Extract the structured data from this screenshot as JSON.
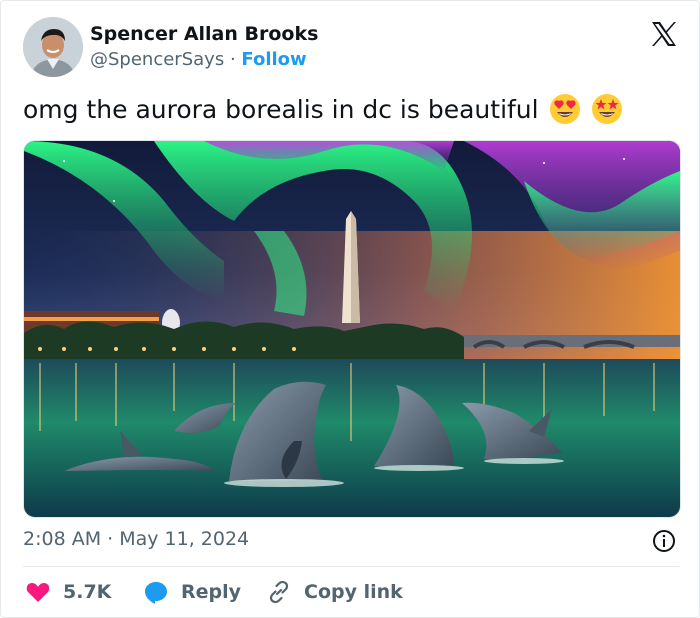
{
  "user": {
    "name": "Spencer Allan Brooks",
    "handle": "@SpencerSays",
    "separator": "·",
    "follow_label": "Follow"
  },
  "tweet": {
    "text": "omg the aurora borealis in dc is beautiful",
    "emojis": [
      "heart-eyes-emoji",
      "star-struck-emoji"
    ],
    "timestamp": "2:08 AM · May 11, 2024"
  },
  "actions": {
    "like_count": "5.7K",
    "reply_label": "Reply",
    "copy_link_label": "Copy link"
  },
  "colors": {
    "accent": "#1d9bf0",
    "like": "#f91880",
    "text_secondary": "#536471"
  },
  "icons": {
    "logo": "x-logo-icon",
    "info": "info-icon",
    "like": "heart-icon",
    "reply": "speech-bubble-icon",
    "copy": "link-icon"
  }
}
